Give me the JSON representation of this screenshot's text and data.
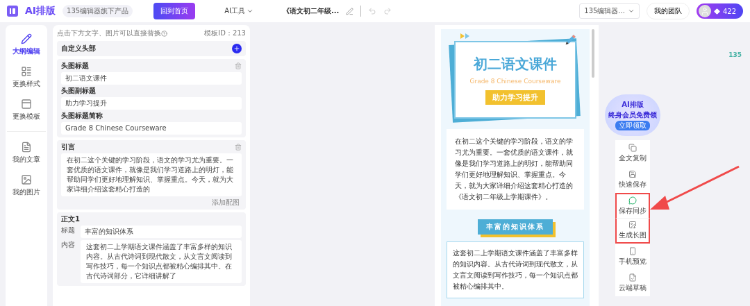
{
  "topbar": {
    "logo": "AI排版",
    "tagline": "135编辑器旗下产品",
    "home_button": "回到首页",
    "ai_tools": "AI工具",
    "doc_title": "《语文初二年级...",
    "undo": {
      "disabled": true
    },
    "redo": {
      "disabled": true
    },
    "editor_select": "135编辑器...",
    "team_button": "我的团队",
    "points": "422"
  },
  "nav": [
    {
      "label": "大纲编辑",
      "selected": true
    },
    {
      "label": "更换样式",
      "selected": false
    },
    {
      "label": "更换模板",
      "selected": false
    },
    {
      "label": "我的文章",
      "selected": false
    },
    {
      "label": "我的图片",
      "selected": false
    }
  ],
  "editor": {
    "hint": "点击下方文字、图片可以直接替换",
    "template_id": "模板ID：213",
    "custom_header": "自定义头部",
    "header_fields": [
      {
        "label": "头图标题",
        "value": "初二语文课件"
      },
      {
        "label": "头图副标题",
        "value": "助力学习提升"
      },
      {
        "label": "头图标题简称",
        "value": "Grade 8 Chinese Courseware"
      }
    ],
    "quote": {
      "title": "引言",
      "text": "在初二这个关键的学习阶段，语文的学习尤为重要。一套优质的语文课件，就像是我们学习道路上的明灯，能帮助同学们更好地理解知识、掌握重点。今天，就为大家详细介绍这套精心打造的",
      "add_image": "添加配图"
    },
    "section": {
      "title": "正文1",
      "heading_label": "标题",
      "heading_value": "丰富的知识体系",
      "content_label": "内容",
      "paragraphs": [
        "这套初二上学期语文课件涵盖了丰富多样的知识内容。从古代诗词到现代散文，从文言文阅读到写作技巧，每一个知识点都被精心编排其中。在古代诗词部分，它详细讲解了"
      ]
    }
  },
  "preview": {
    "title": "初二语文课件",
    "subtitle": "Grade 8 Chinese Courseware",
    "tagline": "助力学习提升",
    "intro": "在初二这个关键的学习阶段，语文的学习尤为重要。一套优质的语文课件，就像是我们学习道路上的明灯，能帮助同学们更好地理解知识、掌握重点。今天，就为大家详细介绍这套精心打造的《语文初二年级上学期课件》。",
    "section_heading": "丰富的知识体系",
    "section_body": "这套初二上学期语文课件涵盖了丰富多样的知识内容。从古代诗词到现代散文，从文言文阅读到写作技巧，每一个知识点都被精心编排其中。"
  },
  "promo": {
    "brand": "AI排版",
    "offer": "终身会员免费领",
    "cta": "立即领取"
  },
  "tools": [
    {
      "label": "全文复制",
      "highlighted": false
    },
    {
      "label": "快速保存",
      "highlighted": false
    },
    {
      "label": "保存同步",
      "highlighted": true
    },
    {
      "label": "生成长图",
      "highlighted": true
    },
    {
      "label": "手机预览",
      "highlighted": false
    },
    {
      "label": "云端草稿",
      "highlighted": false
    }
  ],
  "corner_badge": "135"
}
